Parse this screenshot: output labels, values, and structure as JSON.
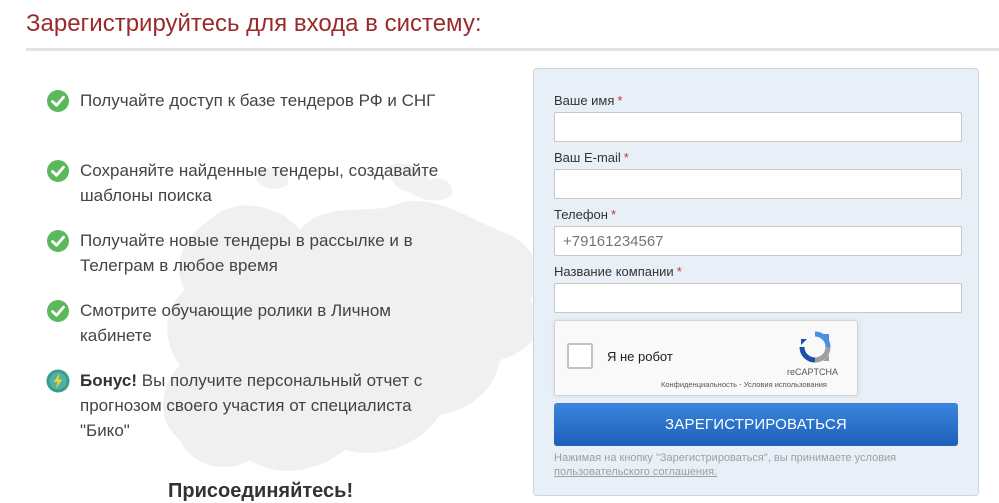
{
  "header": {
    "title": "Зарегистрируйтесь для входа в систему:"
  },
  "benefits": [
    {
      "text": "Получайте доступ к базе тендеров РФ и СНГ",
      "icon": "check-circle-icon"
    },
    {
      "text": "Сохраняйте найденные тендеры, создавайте шаблоны поиска",
      "icon": "check-circle-icon"
    },
    {
      "text": "Получайте новые тендеры в рассылке и в Телеграм в любое время",
      "icon": "check-circle-icon"
    },
    {
      "text": "Смотрите обучающие ролики в Личном кабинете",
      "icon": "check-circle-icon"
    }
  ],
  "bonus": {
    "label": "Бонус!",
    "text": "Вы получите персональный отчет с прогнозом своего участия от специалиста \"Бико\"",
    "icon": "lightning-icon"
  },
  "join_text": "Присоединяйтесь!",
  "form": {
    "name": {
      "label": "Ваше имя",
      "value": "",
      "placeholder": ""
    },
    "email": {
      "label": "Ваш E-mail",
      "value": "",
      "placeholder": ""
    },
    "phone": {
      "label": "Телефон",
      "value": "",
      "placeholder": "+79161234567"
    },
    "company": {
      "label": "Название компании",
      "value": "",
      "placeholder": ""
    },
    "required_mark": "*",
    "captcha": {
      "label": "Я не робот",
      "brand": "reCAPTCHA",
      "privacy": "Конфиденциальность",
      "separator": " - ",
      "terms": "Условия использования"
    },
    "submit_label": "ЗАРЕГИСТРИРОВАТЬСЯ",
    "terms_text": "Нажимая на кнопку \"Зарегистрироваться\", вы принимаете условия",
    "terms_link": "пользовательского соглашения."
  },
  "colors": {
    "title": "#9b2a2a",
    "check": "#5cb85c",
    "bonus_icon": "#3a9c8c",
    "panel": "#e8eff7",
    "button": "#2a72cc"
  }
}
